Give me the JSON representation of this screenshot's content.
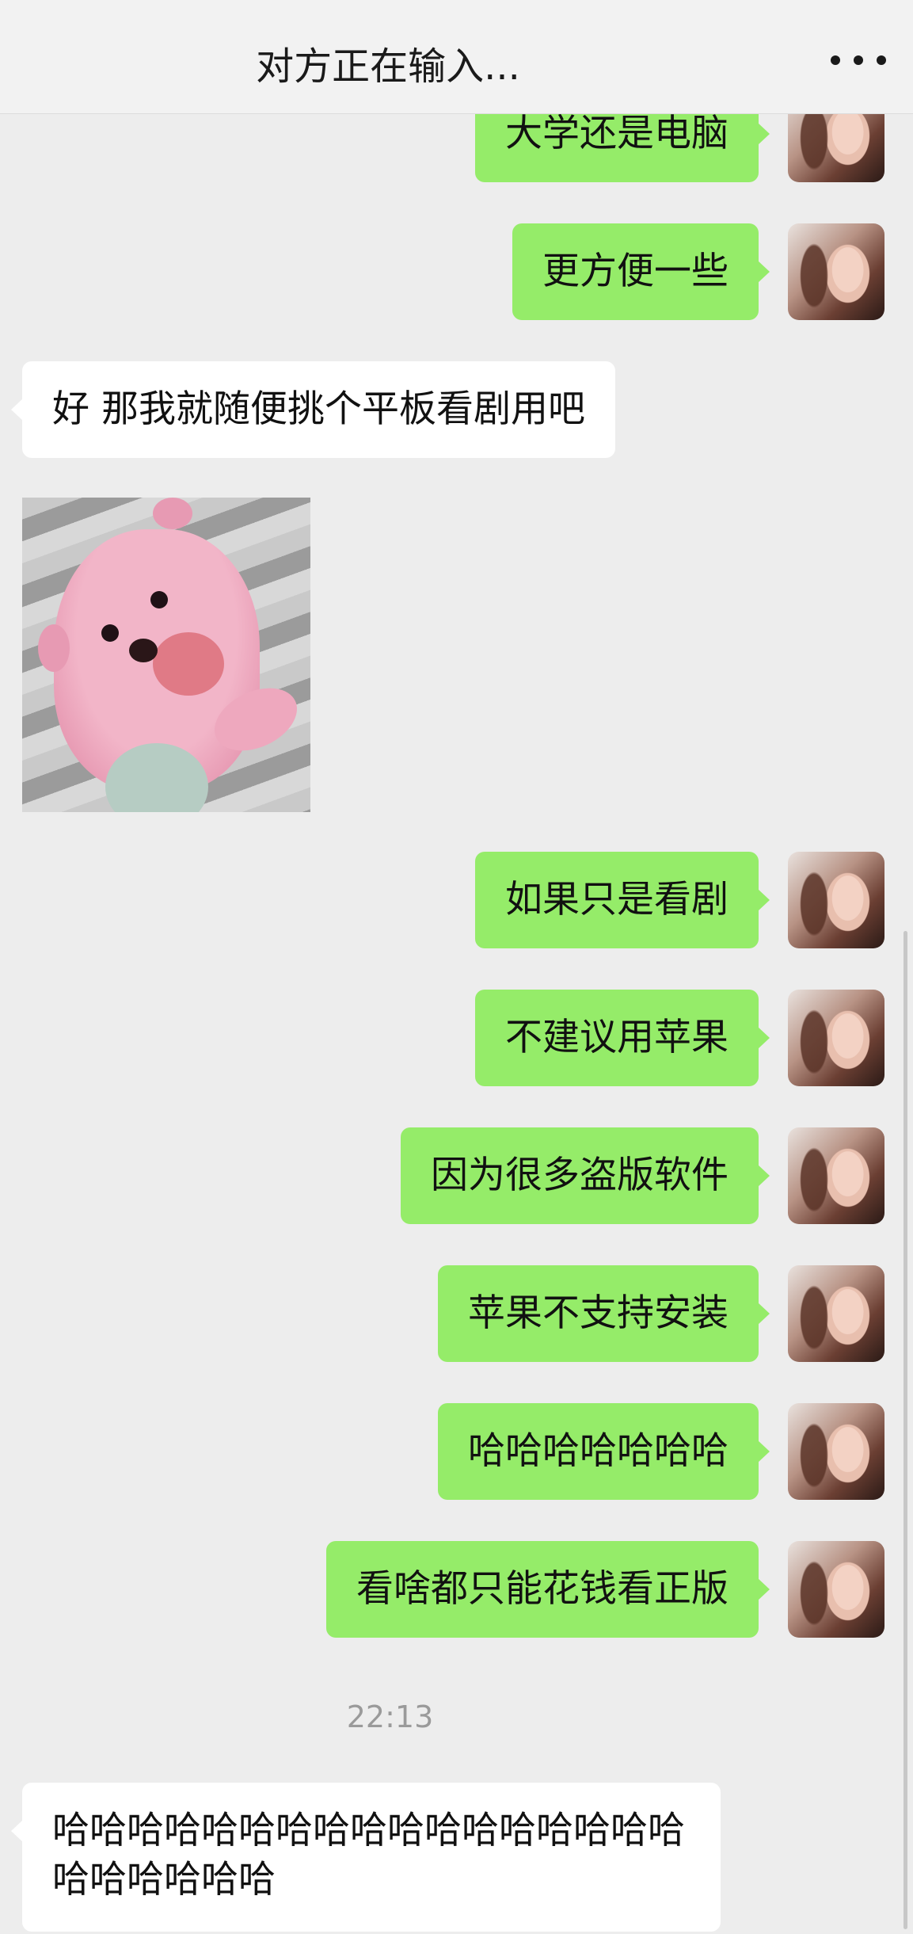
{
  "header": {
    "title": "对方正在输入...",
    "menu_icon": "more-dots-icon"
  },
  "messages": [
    {
      "side": "out",
      "text": "大学还是电脑"
    },
    {
      "side": "out",
      "text": "更方便一些"
    },
    {
      "side": "in",
      "text": "好 那我就随便挑个平板看剧用吧"
    },
    {
      "side": "in",
      "type": "sticker",
      "description_icon": "pink-bear-sticker"
    },
    {
      "side": "out",
      "text": "如果只是看剧"
    },
    {
      "side": "out",
      "text": "不建议用苹果"
    },
    {
      "side": "out",
      "text": "因为很多盗版软件"
    },
    {
      "side": "out",
      "text": "苹果不支持安装"
    },
    {
      "side": "out",
      "text": "哈哈哈哈哈哈哈"
    },
    {
      "side": "out",
      "text": "看啥都只能花钱看正版"
    },
    {
      "side": "in",
      "text": "哈哈哈哈哈哈哈哈哈哈哈哈哈哈哈哈哈哈哈哈哈哈哈"
    }
  ],
  "timestamp": "22:13",
  "colors": {
    "background": "#ededed",
    "outgoing_bubble": "#95ec69",
    "incoming_bubble": "#ffffff"
  }
}
